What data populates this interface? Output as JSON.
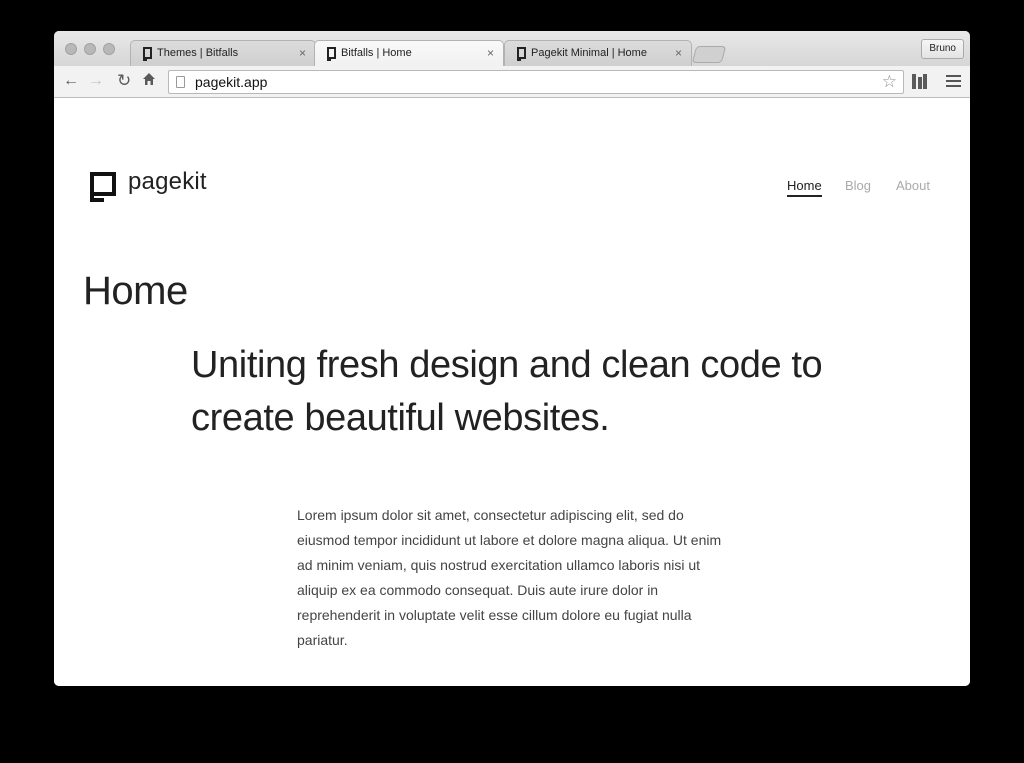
{
  "browser": {
    "tabs": [
      {
        "title": "Themes | Bitfalls",
        "active": false
      },
      {
        "title": "Bitfalls | Home",
        "active": true
      },
      {
        "title": "Pagekit Minimal | Home",
        "active": false
      }
    ],
    "close_glyph": "×",
    "profile_name": "Bruno",
    "url": "pagekit.app",
    "icons": {
      "back": "arrow-left-icon",
      "forward": "arrow-right-icon",
      "reload": "reload-icon",
      "home": "home-icon",
      "bookmark": "star-icon",
      "extension": "extension-icon",
      "menu": "hamburger-menu-icon"
    }
  },
  "site": {
    "logo_text": "pagekit",
    "nav": [
      {
        "label": "Home",
        "active": true
      },
      {
        "label": "Blog",
        "active": false
      },
      {
        "label": "About",
        "active": false
      }
    ],
    "page_title": "Home",
    "lead": "Uniting fresh design and clean code to create beautiful websites.",
    "body": "Lorem ipsum dolor sit amet, consectetur adipiscing elit, sed do eiusmod tempor incididunt ut labore et dolore magna aliqua. Ut enim ad minim veniam, quis nostrud exercitation ullamco laboris nisi ut aliquip ex ea commodo consequat. Duis aute irure dolor in reprehenderit in voluptate velit esse cillum dolore eu fugiat nulla pariatur."
  }
}
